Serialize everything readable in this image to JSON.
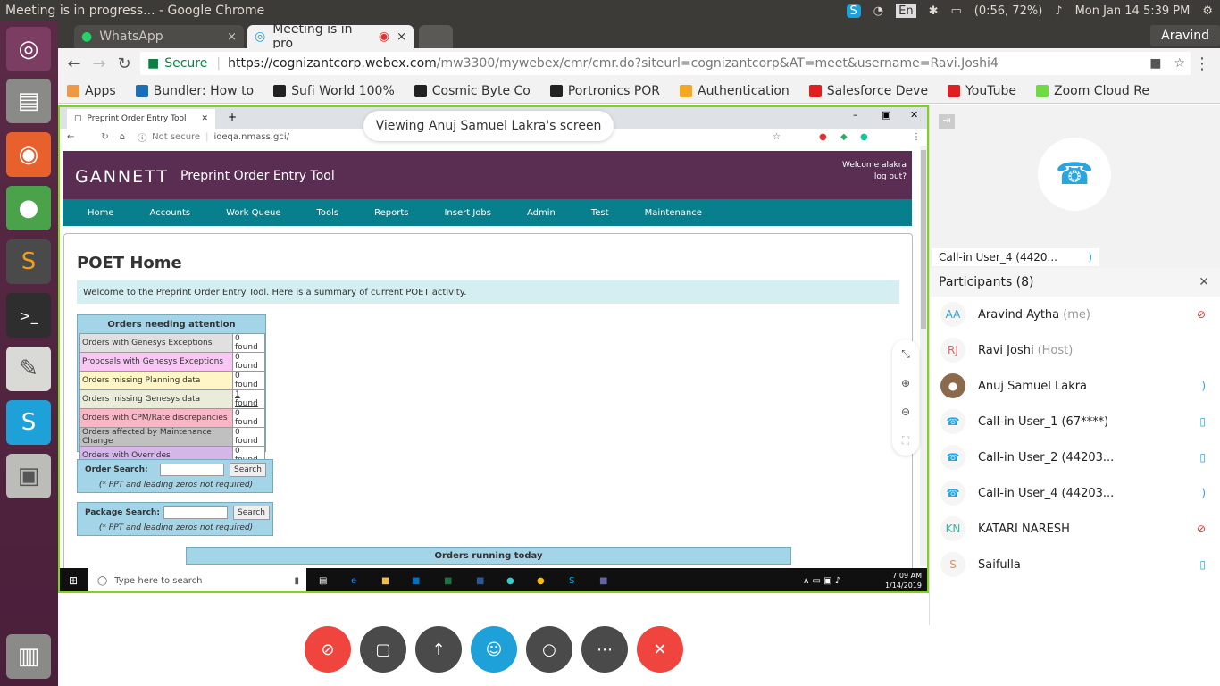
{
  "os": {
    "window_title": "Meeting is in progress... - Google Chrome",
    "input_lang": "En",
    "battery": "(0:56, 72%)",
    "datetime": "Mon Jan 14  5:39 PM"
  },
  "browser": {
    "tabs": [
      {
        "label": "WhatsApp",
        "close": "×"
      },
      {
        "label": "Meeting is in pro",
        "close": "×"
      }
    ],
    "profile": "Aravind",
    "secure_label": "Secure",
    "url_host": "https://cognizantcorp.webex.com",
    "url_path": "/mw3300/mywebex/cmr/cmr.do?siteurl=cognizantcorp&AT=meet&username=Ravi.Joshi4",
    "bookmarks": [
      "Apps",
      "Bundler: How to",
      "Sufi World 100%",
      "Cosmic Byte Co",
      "Portronics POR",
      "Authentication",
      "Salesforce Deve",
      "YouTube",
      "Zoom Cloud Re"
    ]
  },
  "share": {
    "viewing_banner": "Viewing Anuj Samuel Lakra's screen",
    "inner_tab": "Preprint Order Entry Tool",
    "inner_url_prefix": "Not secure",
    "inner_url": "ioeqa.nmass.gci/",
    "brand": "GANNETT",
    "tool_name": "Preprint Order Entry Tool",
    "welcome_user": "Welcome alakra",
    "logout": "log out?",
    "nav": [
      "Home",
      "Accounts",
      "Work Queue",
      "Tools",
      "Reports",
      "Insert Jobs",
      "Admin",
      "Test",
      "Maintenance"
    ],
    "page_title": "POET Home",
    "welcome_text": "Welcome to the Preprint Order Entry Tool.  Here is a summary of current POET activity.",
    "attention_title": "Orders needing attention",
    "attention_rows": [
      {
        "label": "Orders with Genesys Exceptions",
        "count": "0 found",
        "color": "#e0e0e0"
      },
      {
        "label": "Proposals with Genesys Exceptions",
        "count": "0 found",
        "color": "#f9c6f5"
      },
      {
        "label": "Orders missing Planning data",
        "count": "0 found",
        "color": "#fff5c6"
      },
      {
        "label": "Orders missing Genesys data",
        "count": "1 found",
        "color": "#e8ecd8"
      },
      {
        "label": "Orders with CPM/Rate discrepancies",
        "count": "0 found",
        "color": "#f9b6c4"
      },
      {
        "label": "Orders affected by Maintenance Change",
        "count": "0 found",
        "color": "#c0c0c0"
      },
      {
        "label": "Orders with Overrides",
        "count": "0 found",
        "color": "#d5b6e8"
      }
    ],
    "order_search_label": "Order Search:",
    "package_search_label": "Package Search:",
    "search_button": "Search",
    "search_note": "(* PPT and leading zeros not required)",
    "running_title": "Orders running today",
    "win_search": "Type here to search",
    "win_time": "7:09 AM",
    "win_date": "1/14/2019"
  },
  "video": {
    "callin_label": "Call-in User_4 (4420..."
  },
  "participants": {
    "title": "Participants (8)",
    "list": [
      {
        "initials": "AA",
        "name": "Aravind Aytha",
        "role": "(me)",
        "mic": "muted",
        "avatar_color": "#29a6e0"
      },
      {
        "initials": "RJ",
        "name": "Ravi Joshi",
        "role": "(Host)",
        "mic": "none",
        "avatar_color": "#e06060"
      },
      {
        "initials": "",
        "name": "Anuj Samuel Lakra",
        "role": "",
        "mic": "speaking",
        "avatar_color": "#8a6a4a"
      },
      {
        "initials": "",
        "name": "Call-in User_1 (67****)",
        "role": "",
        "mic": "on",
        "avatar_color": "#29a6e0"
      },
      {
        "initials": "",
        "name": "Call-in User_2 (44203...",
        "role": "",
        "mic": "on",
        "avatar_color": "#29a6e0"
      },
      {
        "initials": "",
        "name": "Call-in User_4 (44203...",
        "role": "",
        "mic": "speaking",
        "avatar_color": "#29a6e0"
      },
      {
        "initials": "KN",
        "name": "KATARI NARESH",
        "role": "",
        "mic": "muted",
        "avatar_color": "#3ab5a0"
      },
      {
        "initials": "S",
        "name": "Saifulla",
        "role": "",
        "mic": "on",
        "avatar_color": "#f08a40"
      }
    ]
  },
  "colors": {
    "launcher": "#5a2a46",
    "gannett_header": "#5a2d52",
    "gannett_nav": "#087f8c",
    "webex_red": "#f0443e",
    "webex_blue": "#1ea0d8",
    "webex_gray": "#4a4a4a"
  }
}
